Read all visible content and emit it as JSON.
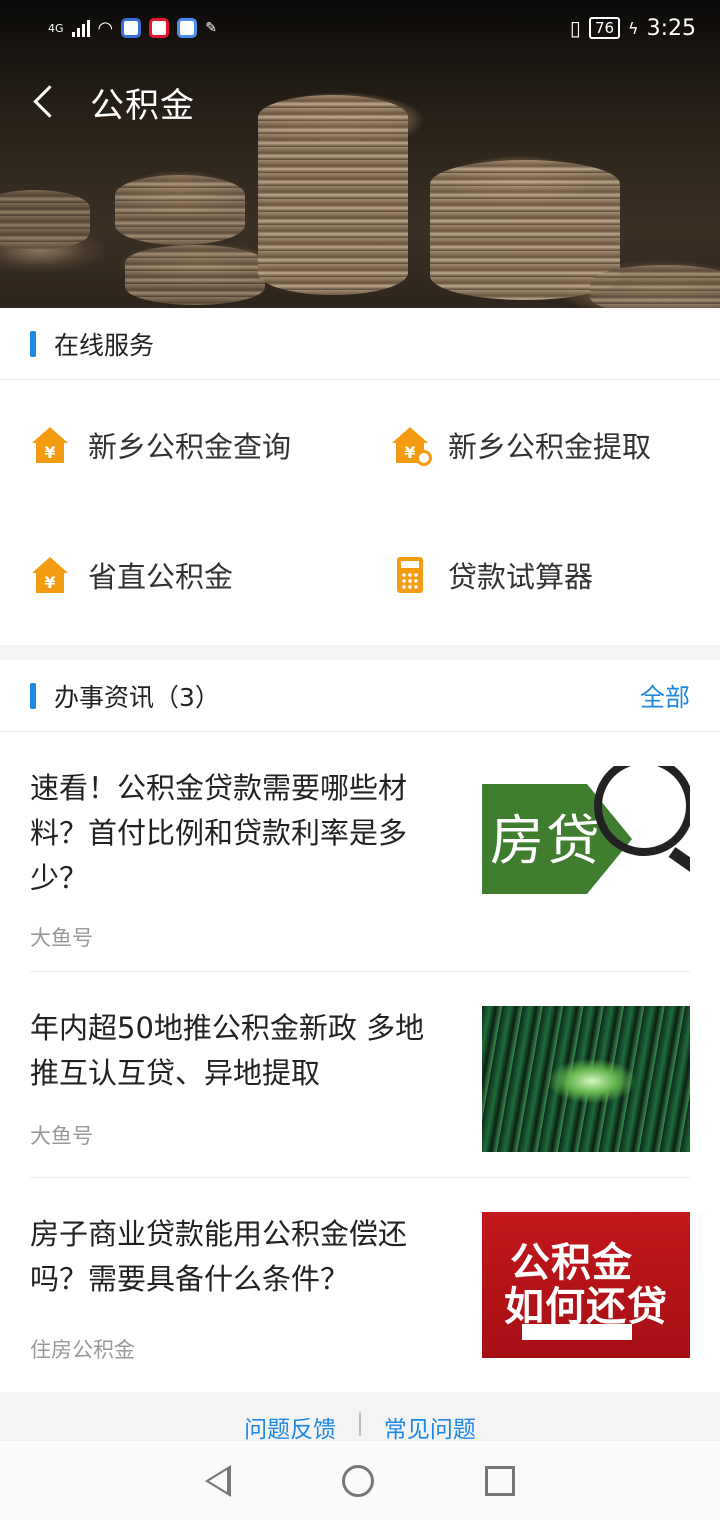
{
  "status_bar": {
    "network": "4G",
    "battery": "76",
    "time": "3:25"
  },
  "header": {
    "title": "公积金"
  },
  "online_services": {
    "title": "在线服务",
    "items": [
      {
        "label": "新乡公积金查询",
        "icon": "house-yuan-icon"
      },
      {
        "label": "新乡公积金提取",
        "icon": "house-yuan-withdraw-icon"
      },
      {
        "label": "省直公积金",
        "icon": "house-yuan-icon"
      },
      {
        "label": "贷款试算器",
        "icon": "calculator-icon"
      }
    ]
  },
  "news": {
    "title": "办事资讯（3）",
    "more_label": "全部",
    "items": [
      {
        "title": "速看！公积金贷款需要哪些材料？首付比例和贷款利率是多少？",
        "source": "大鱼号",
        "thumb_text": "房贷"
      },
      {
        "title": "年内超50地推公积金新政 多地推互认互贷、异地提取",
        "source": "大鱼号"
      },
      {
        "title": "房子商业贷款能用公积金偿还吗？需要具备什么条件？",
        "source": "住房公积金",
        "thumb_text_1": "公积金",
        "thumb_text_2": "如何还贷"
      }
    ]
  },
  "footer": {
    "feedback": "问题反馈",
    "separator": "|",
    "faq": "常见问题"
  },
  "colors": {
    "accent": "#1e88e5",
    "icon_orange": "#f39c12"
  }
}
